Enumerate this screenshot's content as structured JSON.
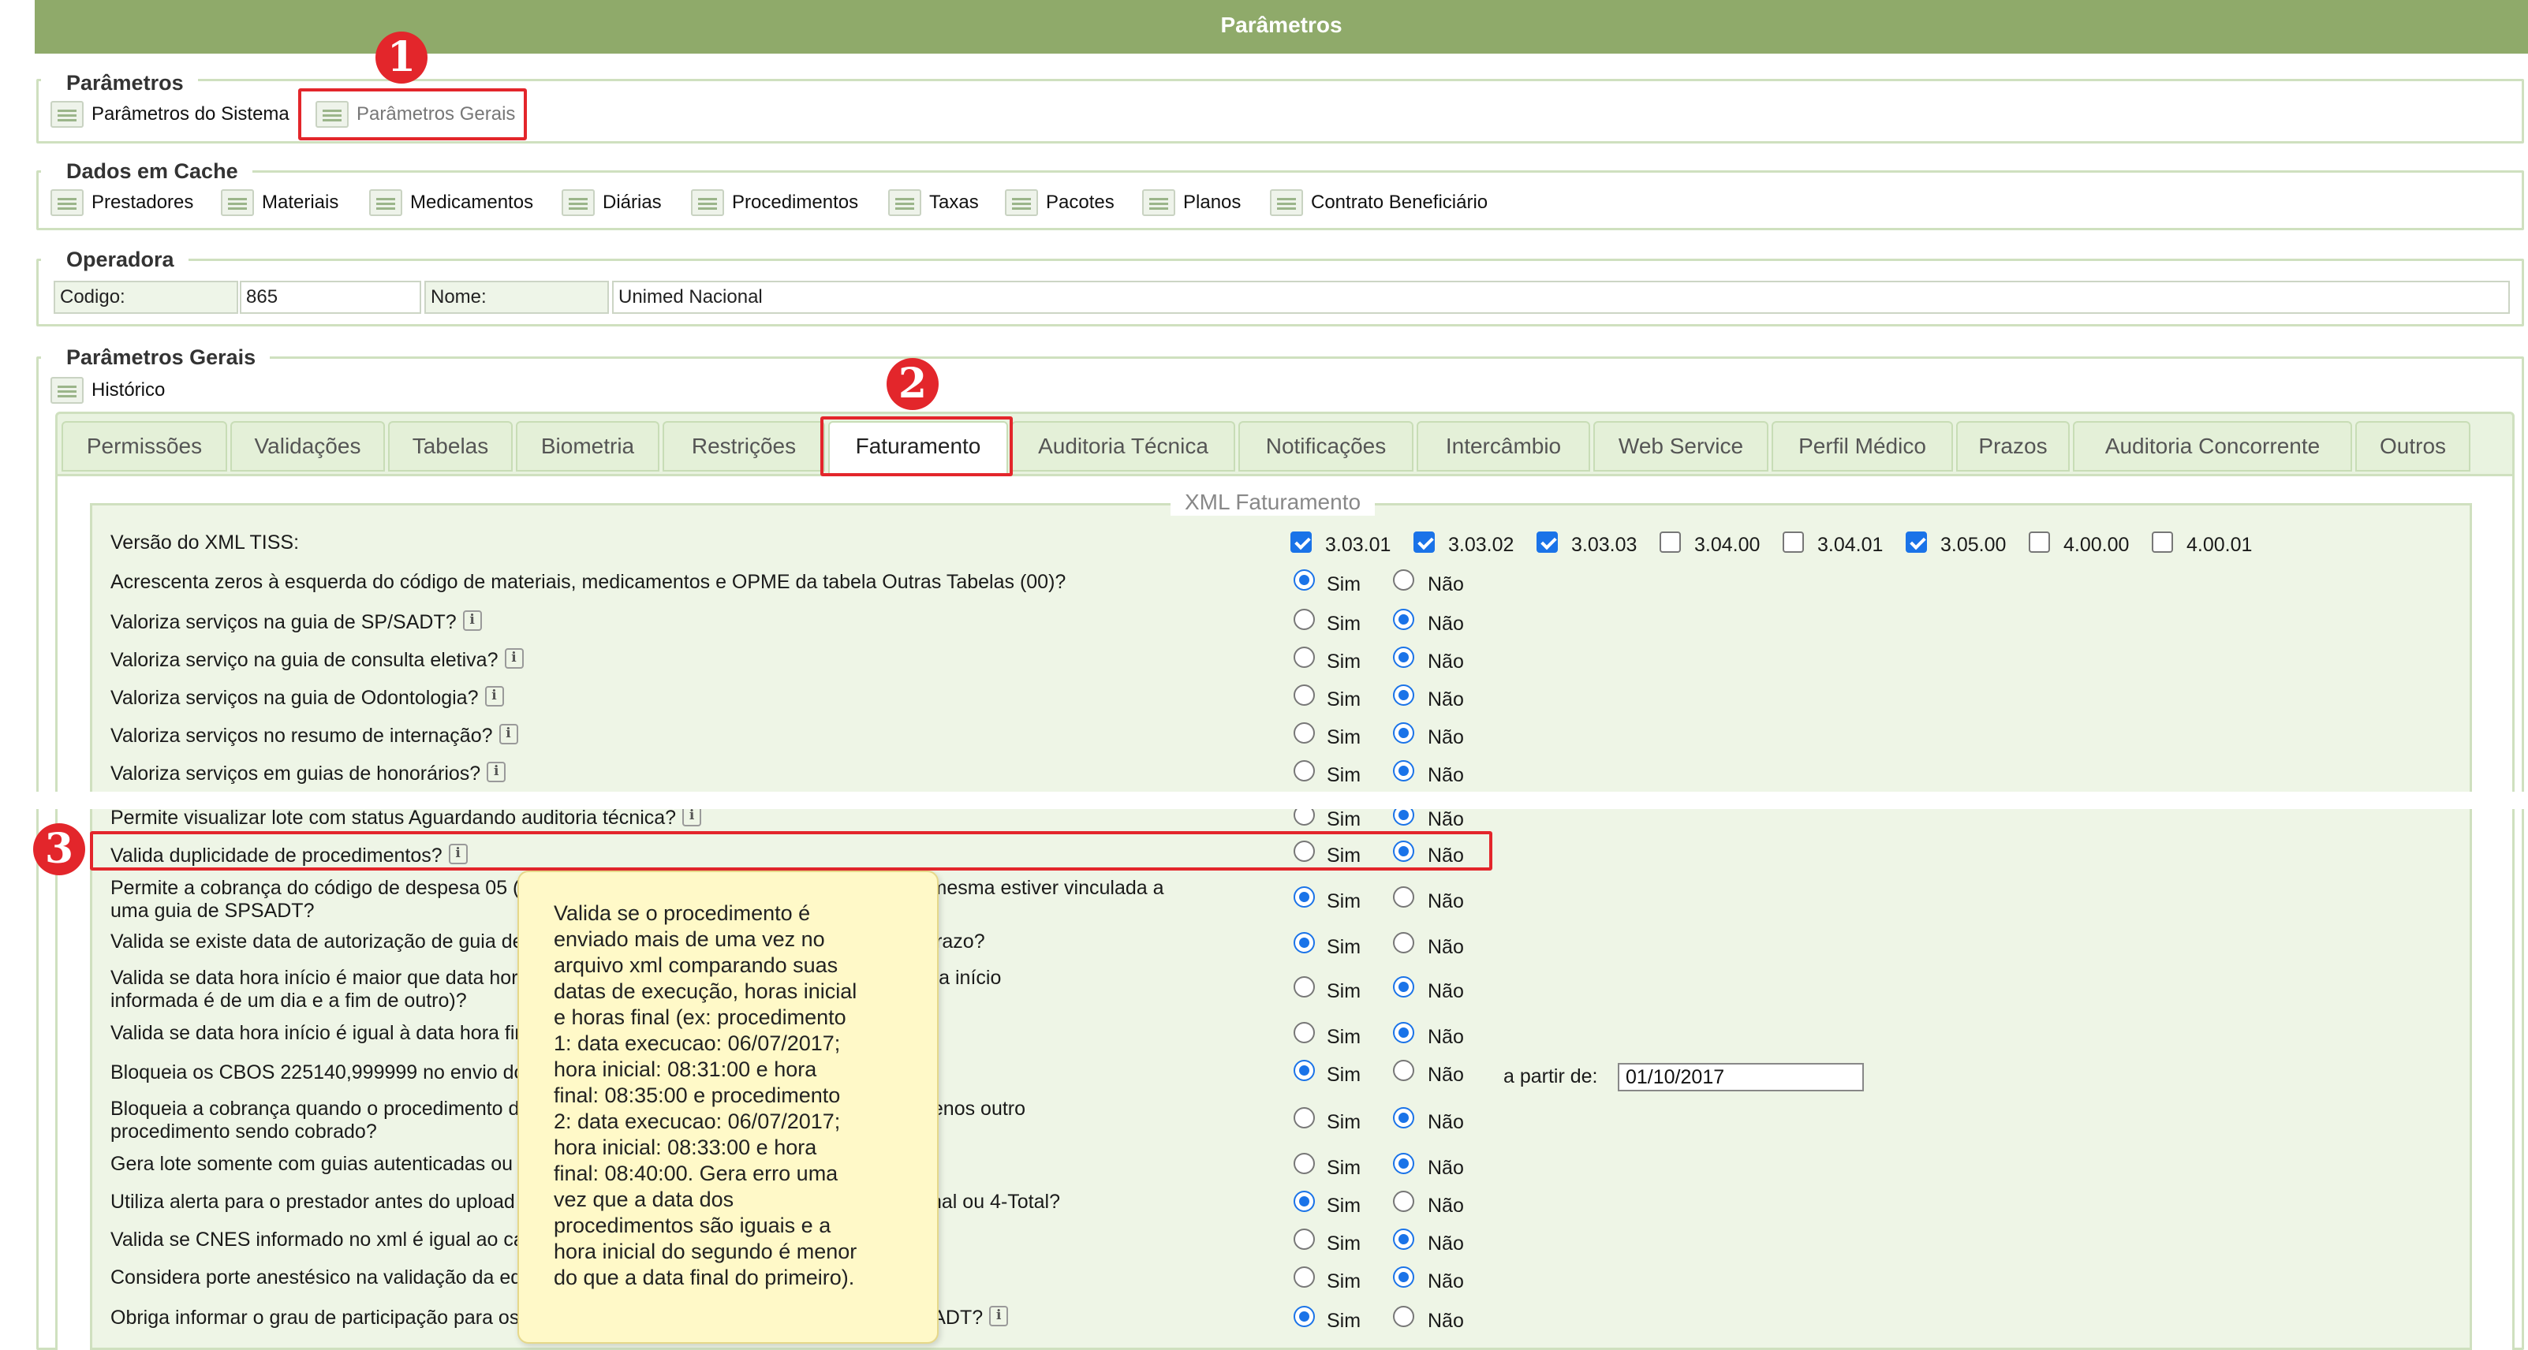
{
  "header": {
    "title": "Parâmetros"
  },
  "sections": {
    "parametros": {
      "legend": "Parâmetros",
      "links": [
        "Parâmetros do Sistema",
        "Parâmetros Gerais"
      ]
    },
    "cache": {
      "legend": "Dados em Cache",
      "links": [
        "Prestadores",
        "Materiais",
        "Medicamentos",
        "Diárias",
        "Procedimentos",
        "Taxas",
        "Pacotes",
        "Planos",
        "Contrato Beneficiário"
      ]
    },
    "operadora": {
      "legend": "Operadora",
      "codigo_label": "Codigo:",
      "codigo_value": "865",
      "nome_label": "Nome:",
      "nome_value": "Unimed Nacional"
    },
    "gerais": {
      "legend": "Parâmetros Gerais",
      "historico": "Histórico"
    }
  },
  "tabs": [
    "Permissões",
    "Validações",
    "Tabelas",
    "Biometria",
    "Restrições",
    "Faturamento",
    "Auditoria Técnica",
    "Notificações",
    "Intercâmbio",
    "Web Service",
    "Perfil Médico",
    "Prazos",
    "Auditoria Concorrente",
    "Outros"
  ],
  "active_tab": "Faturamento",
  "xml": {
    "legend": "XML Faturamento",
    "versao_label": "Versão do XML TISS:",
    "versions": [
      {
        "label": "3.03.01",
        "checked": true
      },
      {
        "label": "3.03.02",
        "checked": true
      },
      {
        "label": "3.03.03",
        "checked": true
      },
      {
        "label": "3.04.00",
        "checked": false
      },
      {
        "label": "3.04.01",
        "checked": false
      },
      {
        "label": "3.05.00",
        "checked": true
      },
      {
        "label": "4.00.00",
        "checked": false
      },
      {
        "label": "4.00.01",
        "checked": false
      }
    ],
    "sim": "Sim",
    "nao": "Não",
    "a_partir_label": "a partir de:",
    "a_partir_value": "01/10/2017",
    "questions": [
      {
        "l1": "Acrescenta zeros à esquerda do código de materiais, medicamentos e OPME da tabela Outras Tabelas (00)?",
        "l2": "",
        "answer": "sim",
        "info": false
      },
      {
        "l1": "Valoriza serviços na guia de SP/SADT?",
        "l2": "",
        "answer": "nao",
        "info": true
      },
      {
        "l1": "Valoriza serviço na guia de consulta eletiva?",
        "l2": "",
        "answer": "nao",
        "info": true
      },
      {
        "l1": "Valoriza serviços na guia de Odontologia?",
        "l2": "",
        "answer": "nao",
        "info": true
      },
      {
        "l1": "Valoriza serviços no resumo de internação?",
        "l2": "",
        "answer": "nao",
        "info": true
      },
      {
        "l1": "Valoriza serviços em guias de honorários?",
        "l2": "",
        "answer": "nao",
        "info": true
      },
      {
        "l1": "Permite visualizar lote com status Aguardando auditoria técnica?",
        "l2": "",
        "answer": "nao",
        "info": true
      },
      {
        "l1": "Valida duplicidade de procedimentos?",
        "l2": "",
        "answer": "nao",
        "info": true
      },
      {
        "l1": "Permite a cobrança do código de despesa 05 (diárias) em guia de outras despesas quando a mesma estiver vinculada a",
        "l2": "uma guia de SPSADT?",
        "answer": "sim",
        "info": false
      },
      {
        "l1": "Valida se existe data de autorização de guia de internação permitindo o envio de lote fora do prazo?",
        "l2": "",
        "answer": "sim",
        "info": false
      },
      {
        "l1": "Valida se data hora início é maior que data hora final do procedimento (Obs: gera erro se a hora início",
        "l2": "informada é de um dia e a fim de outro)?",
        "answer": "nao",
        "info": false
      },
      {
        "l1": "Valida se data hora início é igual à data hora final?",
        "l2": "",
        "answer": "nao",
        "info": false
      },
      {
        "l1": "Bloqueia os CBOS 225140,999999 no envio do XML?",
        "l2": "",
        "answer": "sim",
        "info": false
      },
      {
        "l1": "Bloqueia a cobrança quando o procedimento de consulta em guia SP/SADT não tenha pelo menos outro",
        "l2": "procedimento sendo cobrado?",
        "answer": "nao",
        "info": false
      },
      {
        "l1": "Gera lote somente com guias autenticadas ou com biometria validada na recepção?",
        "l2": "",
        "answer": "nao",
        "info": false
      },
      {
        "l1": "Utiliza alerta para o prestador antes do upload do XML quando existe tipo de faturamento 2-Final ou 4-Total?",
        "l2": "",
        "answer": "sim",
        "info": false
      },
      {
        "l1": "Valida se CNES informado no xml é igual ao cadastrado?",
        "l2": "",
        "answer": "nao",
        "info": false
      },
      {
        "l1": "Considera porte anestésico na validação da equipe?",
        "l2": "",
        "answer": "nao",
        "info": false
      },
      {
        "l1": "Obriga informar o grau de participação para os membros da equipe no upload do xml de SP/SADT?",
        "l2": "",
        "answer": "sim",
        "info": true
      }
    ]
  },
  "tooltip": {
    "lines": [
      "Valida se o procedimento é",
      "enviado mais de uma vez no",
      "arquivo xml comparando suas",
      "datas de execução, horas inicial",
      "e horas final (ex: procedimento",
      "1: data execucao: 06/07/2017;",
      "hora inicial: 08:31:00 e hora",
      "final: 08:35:00 e procedimento",
      "2: data execucao: 06/07/2017;",
      "hora inicial: 08:33:00 e hora",
      "final: 08:40:00. Gera erro uma",
      "vez que a data dos",
      "procedimentos são iguais e a",
      "hora inicial do segundo é menor",
      "do que a data final do primeiro)."
    ]
  },
  "badges": [
    "1",
    "2",
    "3"
  ],
  "colors": {
    "header": "#8faa6a",
    "highlight": "#e3262b",
    "tooltip": "#fff9c8",
    "panel": "#eef5e6"
  }
}
